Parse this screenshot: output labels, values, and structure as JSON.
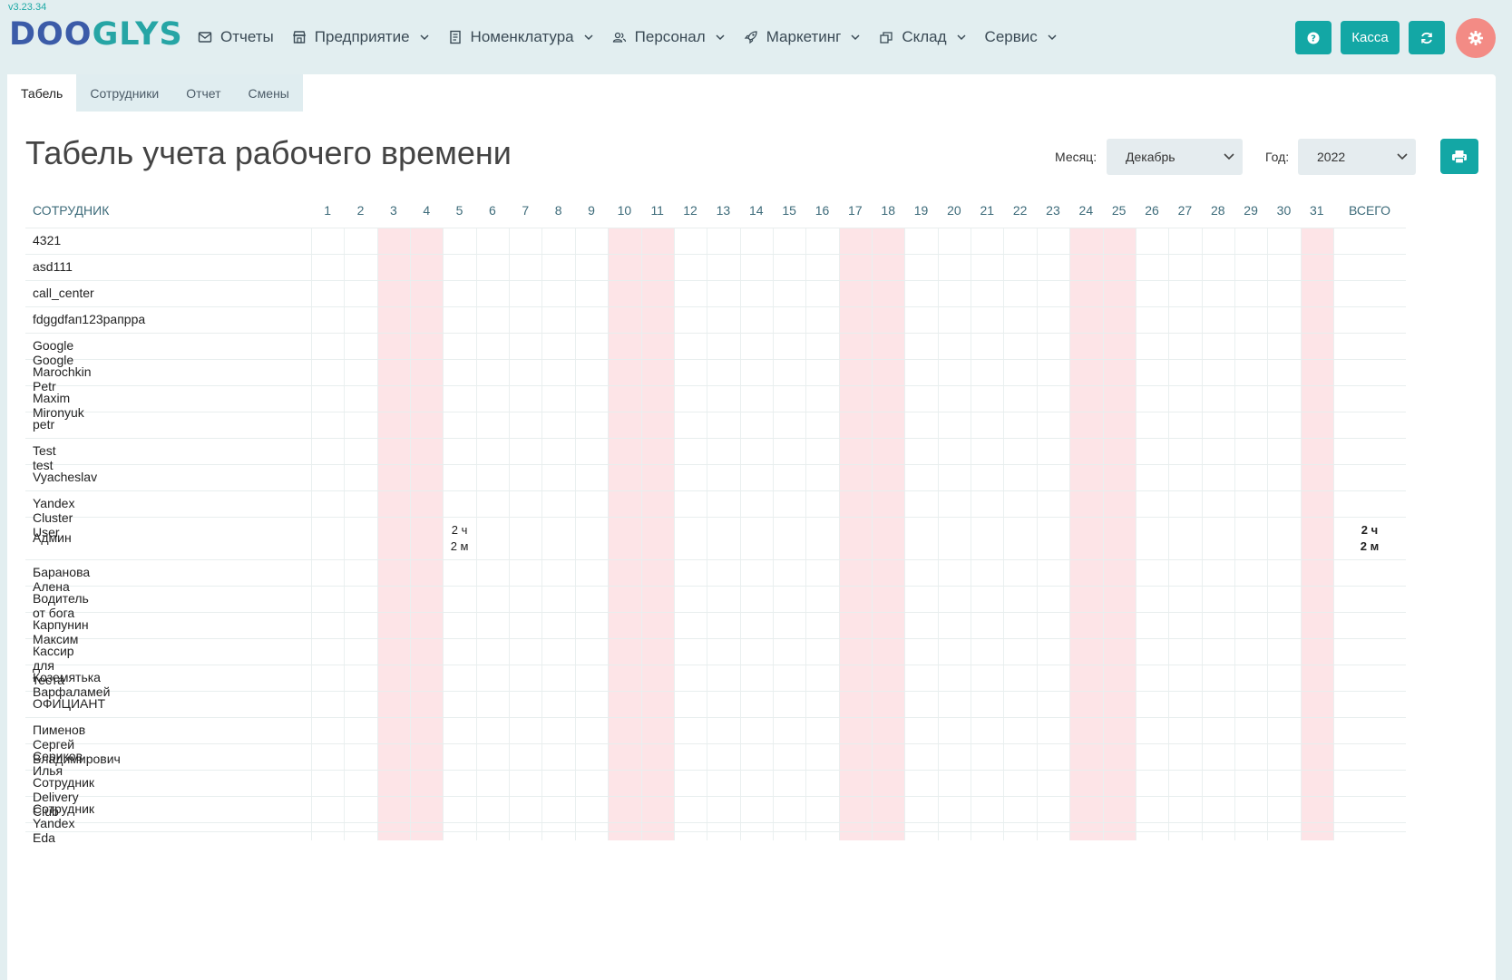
{
  "app": {
    "version": "v3.23.34",
    "logo_part1": "DOO",
    "logo_part2": "GLYS"
  },
  "nav": [
    {
      "label": "Отчеты",
      "icon": "mail-icon",
      "dropdown": false
    },
    {
      "label": "Предприятие",
      "icon": "store-icon",
      "dropdown": true
    },
    {
      "label": "Номенклатура",
      "icon": "document-icon",
      "dropdown": true
    },
    {
      "label": "Персонал",
      "icon": "users-icon",
      "dropdown": true
    },
    {
      "label": "Маркетинг",
      "icon": "rocket-icon",
      "dropdown": true
    },
    {
      "label": "Склад",
      "icon": "boxes-icon",
      "dropdown": true
    },
    {
      "label": "Сервис",
      "icon": "",
      "dropdown": true
    }
  ],
  "toolbar": {
    "help_icon": "question-icon",
    "kassa_label": "Касса",
    "refresh_icon": "refresh-icon",
    "settings_icon": "gear-icon"
  },
  "tabs": [
    {
      "label": "Табель",
      "active": true
    },
    {
      "label": "Сотрудники",
      "active": false
    },
    {
      "label": "Отчет",
      "active": false
    },
    {
      "label": "Смены",
      "active": false
    }
  ],
  "page": {
    "title": "Табель учета рабочего времени",
    "month_label": "Месяц:",
    "month_value": "Декабрь",
    "year_label": "Год:",
    "year_value": "2022",
    "print_icon": "printer-icon"
  },
  "table": {
    "employee_header": "СОТРУДНИК",
    "total_header": "ВСЕГО",
    "days": [
      "1",
      "2",
      "3",
      "4",
      "5",
      "6",
      "7",
      "8",
      "9",
      "10",
      "11",
      "12",
      "13",
      "14",
      "15",
      "16",
      "17",
      "18",
      "19",
      "20",
      "21",
      "22",
      "23",
      "24",
      "25",
      "26",
      "27",
      "28",
      "29",
      "30",
      "31"
    ],
    "weekend_days": [
      3,
      4,
      10,
      11,
      17,
      18,
      24,
      25,
      31
    ],
    "employees": [
      {
        "name": "4321"
      },
      {
        "name": "asd111"
      },
      {
        "name": "call_center"
      },
      {
        "name": "fdggdfап123рапрра"
      },
      {
        "name": "Google Google"
      },
      {
        "name": "Marochkin Petr"
      },
      {
        "name": "Maxim Mironyuk"
      },
      {
        "name": "petr"
      },
      {
        "name": "Test test"
      },
      {
        "name": "Vyacheslav"
      },
      {
        "name": "Yandex Cluster User"
      },
      {
        "name": "Админ",
        "day": 5,
        "hours": "2 ч",
        "minutes": "2 м",
        "total_hours": "2 ч",
        "total_minutes": "2 м"
      },
      {
        "name": "Баранова Алена"
      },
      {
        "name": "Водитель от бога"
      },
      {
        "name": "Карпунин Максим"
      },
      {
        "name": "Кассир для теста"
      },
      {
        "name": "Коземятька Варфаламей"
      },
      {
        "name": "ОФИЦИАНТ"
      },
      {
        "name": "Пименов Сергей Владимирович"
      },
      {
        "name": "Сериков Илья"
      },
      {
        "name": "Сотрудник Delivery Club"
      },
      {
        "name": "Сотрудник Yandex Eda"
      }
    ]
  },
  "colors": {
    "accent": "#13a7a5",
    "weekend": "#fde4e7",
    "settings_button": "#f38b85"
  }
}
